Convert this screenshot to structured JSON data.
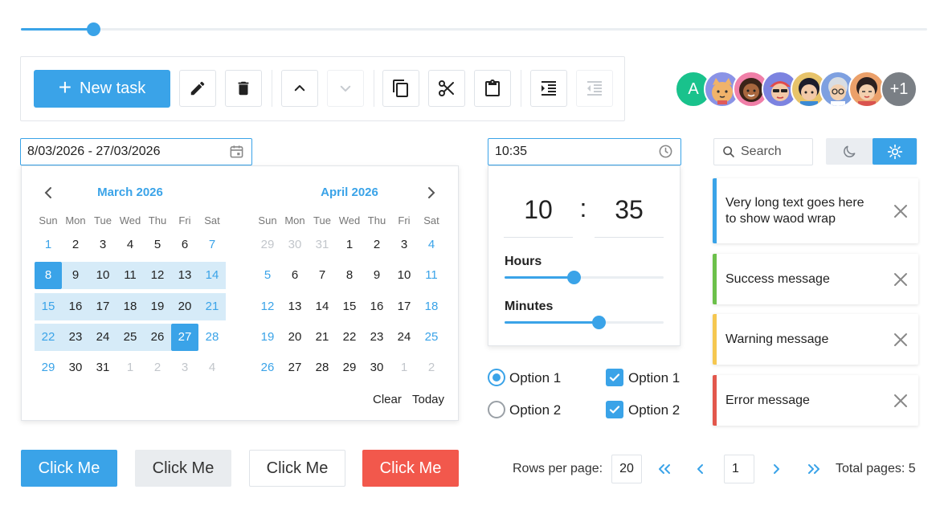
{
  "top_slider": {
    "value_percent": 8
  },
  "toolbar": {
    "new_task_label": "New task",
    "buttons": [
      "pencil-icon",
      "trash-icon",
      "chevron-up-icon",
      "chevron-down-icon",
      "copy-icon",
      "scissors-icon",
      "clipboard-icon",
      "indent-icon",
      "outdent-icon"
    ]
  },
  "avatars": {
    "first_initial": "A",
    "more_label": "+1"
  },
  "date_range": {
    "value": "8/03/2026 - 27/03/2026",
    "left_month": "March 2026",
    "right_month": "April 2026",
    "weekdays": [
      "Sun",
      "Mon",
      "Tue",
      "Wed",
      "Thu",
      "Fri",
      "Sat"
    ],
    "left_days": [
      [
        "1",
        "2",
        "3",
        "4",
        "5",
        "6",
        "7"
      ],
      [
        "8",
        "9",
        "10",
        "11",
        "12",
        "13",
        "14"
      ],
      [
        "15",
        "16",
        "17",
        "18",
        "19",
        "20",
        "21"
      ],
      [
        "22",
        "23",
        "24",
        "25",
        "26",
        "27",
        "28"
      ],
      [
        "29",
        "30",
        "31",
        "1",
        "2",
        "3",
        "4"
      ]
    ],
    "right_days": [
      [
        "29",
        "30",
        "31",
        "1",
        "2",
        "3",
        "4"
      ],
      [
        "5",
        "6",
        "7",
        "8",
        "9",
        "10",
        "11"
      ],
      [
        "12",
        "13",
        "14",
        "15",
        "16",
        "17",
        "18"
      ],
      [
        "19",
        "20",
        "21",
        "22",
        "23",
        "24",
        "25"
      ],
      [
        "26",
        "27",
        "28",
        "29",
        "30",
        "1",
        "2"
      ]
    ],
    "clear_label": "Clear",
    "today_label": "Today"
  },
  "time": {
    "value": "10:35",
    "hours": "10",
    "separator": ":",
    "minutes": "35",
    "hours_label": "Hours",
    "minutes_label": "Minutes",
    "hours_value": 10,
    "minutes_value": 35
  },
  "radios": [
    {
      "label": "Option 1",
      "checked": true
    },
    {
      "label": "Option 2",
      "checked": false
    }
  ],
  "checkboxes": [
    {
      "label": "Option 1",
      "checked": true
    },
    {
      "label": "Option 2",
      "checked": true
    }
  ],
  "search": {
    "placeholder": "Search"
  },
  "theme_toggle": {
    "active": "light"
  },
  "messages": [
    {
      "text": "Very long text goes here to show waod wrap",
      "color": "#3aa3e8"
    },
    {
      "text": "Success message",
      "color": "#6cc04a"
    },
    {
      "text": "Warning message",
      "color": "#f5c750"
    },
    {
      "text": "Error message",
      "color": "#e2574c"
    }
  ],
  "buttons": [
    "Click Me",
    "Click Me",
    "Click Me",
    "Click Me"
  ],
  "pagination": {
    "rows_label": "Rows per page:",
    "rows_value": "20",
    "page_value": "1",
    "total_label": "Total pages: 5"
  }
}
